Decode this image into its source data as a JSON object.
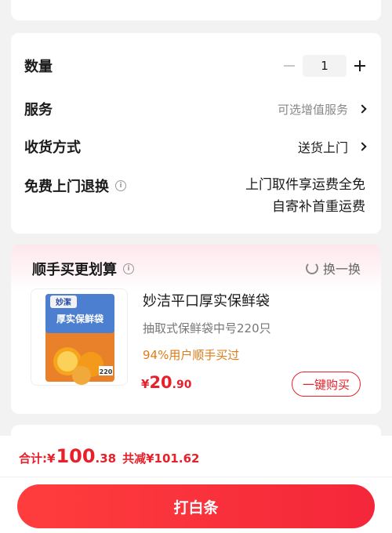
{
  "options": {
    "quantity_label": "数量",
    "quantity_value": "1",
    "service_label": "服务",
    "service_value": "可选增值服务",
    "delivery_label": "收货方式",
    "delivery_value": "送货上门",
    "free_return_label": "免费上门退换",
    "free_return_line1": "上门取件享运费全免",
    "free_return_line2": "自寄补首重运费"
  },
  "recommend": {
    "title": "顺手买更划算",
    "swap_label": "换一换",
    "product": {
      "name": "妙洁平口厚实保鲜袋",
      "spec": "抽取式保鲜袋中号220只",
      "note": "94%用户顺手买过",
      "price_symbol": "¥",
      "price_int": "20",
      "price_dec": ".90",
      "image_brand": "妙潔",
      "image_title": "厚实保鲜袋",
      "image_count": "220",
      "buy_label": "一键购买"
    }
  },
  "footer": {
    "total_label": "合计: ",
    "total_symbol": "¥",
    "total_int": "100",
    "total_dec": ".38",
    "discount": "共减¥101.62",
    "pay_button": "打白条"
  },
  "colors": {
    "accent_red": "#e8202a",
    "note_orange": "#e07b16"
  }
}
